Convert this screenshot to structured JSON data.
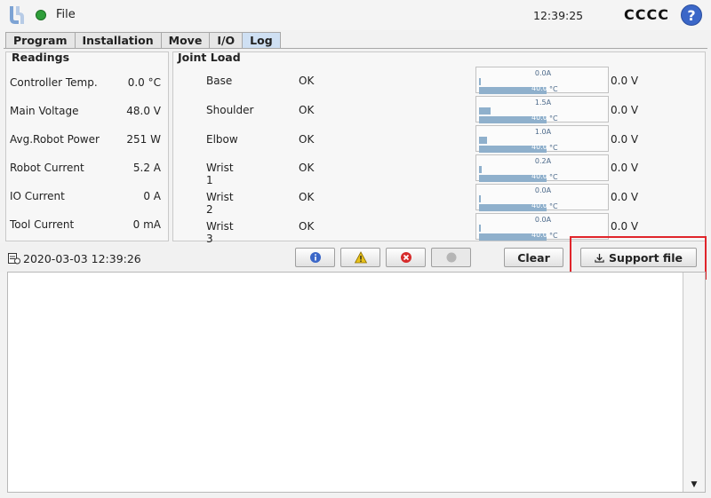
{
  "header": {
    "file_label": "File",
    "time": "12:39:25",
    "robot_name": "CCCC",
    "help_symbol": "?",
    "status_color": "#2f9e3a"
  },
  "tabs": [
    {
      "label": "Program",
      "active": false
    },
    {
      "label": "Installation",
      "active": false
    },
    {
      "label": "Move",
      "active": false
    },
    {
      "label": "I/O",
      "active": false
    },
    {
      "label": "Log",
      "active": true
    }
  ],
  "readings": {
    "title": "Readings",
    "rows": [
      {
        "label": "Controller Temp.",
        "value": "0.0 °C"
      },
      {
        "label": "Main Voltage",
        "value": "48.0  V"
      },
      {
        "label": "Avg.Robot Power",
        "value": "251  W"
      },
      {
        "label": "Robot Current",
        "value": "5.2  A"
      },
      {
        "label": "IO Current",
        "value": "0  A"
      },
      {
        "label": "Tool Current",
        "value": "0 mA"
      }
    ]
  },
  "joint_load": {
    "title": "Joint Load",
    "temp_unit": "°C",
    "joints": [
      {
        "name": "Base",
        "status": "OK",
        "current": "0.0A",
        "current_fraction": 0.0,
        "temp": "40.0",
        "voltage": "0.0 V"
      },
      {
        "name": "Shoulder",
        "status": "OK",
        "current": "1.5A",
        "current_fraction": 0.09,
        "temp": "40.0",
        "voltage": "0.0 V"
      },
      {
        "name": "Elbow",
        "status": "OK",
        "current": "1.0A",
        "current_fraction": 0.06,
        "temp": "40.0",
        "voltage": "0.0 V"
      },
      {
        "name": "Wrist 1",
        "status": "OK",
        "current": "0.2A",
        "current_fraction": 0.02,
        "temp": "40.0",
        "voltage": "0.0 V"
      },
      {
        "name": "Wrist 2",
        "status": "OK",
        "current": "0.0A",
        "current_fraction": 0.0,
        "temp": "40.0",
        "voltage": "0.0 V"
      },
      {
        "name": "Wrist 3",
        "status": "OK",
        "current": "0.0A",
        "current_fraction": 0.0,
        "temp": "40.0",
        "voltage": "0.0 V"
      }
    ]
  },
  "toolbar": {
    "timestamp": "2020-03-03 12:39:26",
    "clear_label": "Clear",
    "support_label": "Support file",
    "info_color": "#3b67c8",
    "warning_color": "#e8c21a",
    "error_color": "#d62b2b",
    "disabled_color": "#b5b5b5"
  },
  "icons": {
    "logo": "ur-logo-icon",
    "info": "info-icon",
    "warning": "warning-icon",
    "error": "error-icon",
    "debug": "debug-icon",
    "download": "download-icon",
    "document": "document-icon"
  }
}
